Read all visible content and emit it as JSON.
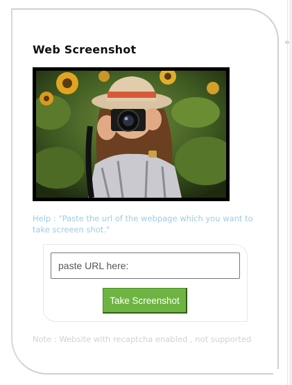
{
  "card": {
    "title": "Web Screenshot",
    "image_alt": "photo-of-woman-holding-camera"
  },
  "help_text": "Help : \"Paste the url of the webpage which you want to take screeen shot.\"",
  "form": {
    "url_placeholder": "paste URL here:",
    "url_value": "",
    "submit_label": "Take Screenshot"
  },
  "note_text": "Note : Website with recaptcha enabled , not supported",
  "colors": {
    "accent_button": "#6eb442",
    "help_text": "#9ecbe6",
    "note_text": "#d2d2d2"
  }
}
